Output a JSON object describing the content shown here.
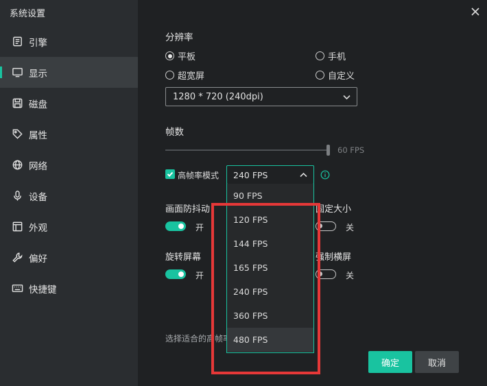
{
  "window": {
    "title": "系统设置"
  },
  "sidebar": {
    "items": [
      {
        "label": "引擎",
        "icon": "engine-icon"
      },
      {
        "label": "显示",
        "icon": "monitor-icon",
        "active": true
      },
      {
        "label": "磁盘",
        "icon": "disk-icon"
      },
      {
        "label": "属性",
        "icon": "tag-icon"
      },
      {
        "label": "网络",
        "icon": "globe-icon"
      },
      {
        "label": "设备",
        "icon": "microphone-icon"
      },
      {
        "label": "外观",
        "icon": "layout-icon"
      },
      {
        "label": "偏好",
        "icon": "wrench-icon"
      },
      {
        "label": "快捷键",
        "icon": "keyboard-icon"
      }
    ]
  },
  "resolution": {
    "title": "分辨率",
    "options": [
      {
        "label": "平板",
        "checked": true
      },
      {
        "label": "手机",
        "checked": false
      },
      {
        "label": "超宽屏",
        "checked": false
      },
      {
        "label": "自定义",
        "checked": false
      }
    ],
    "selected": "1280 * 720 (240dpi)"
  },
  "framerate": {
    "title": "帧数",
    "slider_value_label": "60 FPS",
    "slider_fraction": 1.0,
    "high_fps_label": "高帧率模式",
    "high_fps_checked": true,
    "fps_selected": "240 FPS",
    "fps_options": [
      "90 FPS",
      "120 FPS",
      "144 FPS",
      "165 FPS",
      "240 FPS",
      "360 FPS",
      "480 FPS"
    ],
    "hovered_option": "480 FPS"
  },
  "toggles": {
    "anti_shake": {
      "title": "画面防抖动",
      "state": "开",
      "on": true
    },
    "fixed_size": {
      "title": "固定大小",
      "state": "关",
      "on": false
    },
    "rotate": {
      "title": "旋转屏幕",
      "state": "开",
      "on": true
    },
    "force_landscape": {
      "title": "强制横屏",
      "state": "关",
      "on": false
    }
  },
  "hint": "选择适合的高帧率",
  "buttons": {
    "ok": "确定",
    "cancel": "取消"
  },
  "colors": {
    "accent": "#19c3a0",
    "highlight": "#e63838",
    "sidebar_bg": "#2a2d30",
    "content_bg": "#1f2123"
  }
}
